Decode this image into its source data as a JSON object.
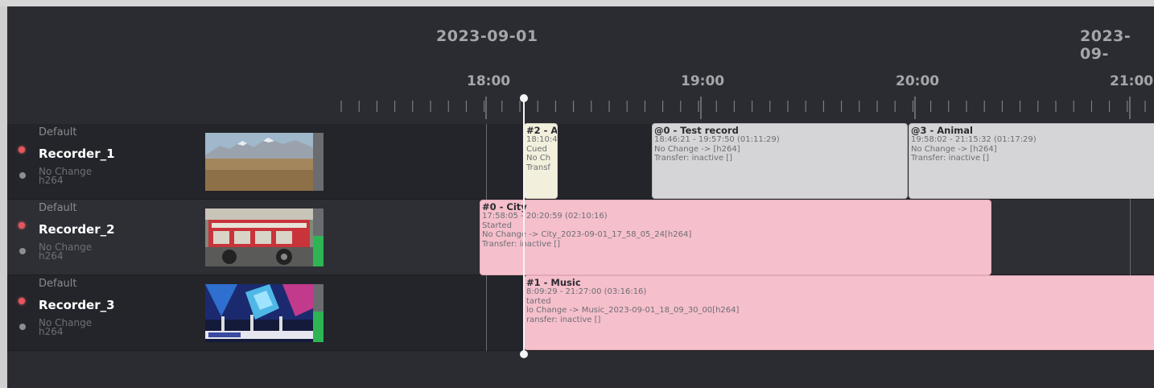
{
  "timeline": {
    "dates": [
      "2023-09-01",
      "2023-09-"
    ],
    "hours": [
      "18:00",
      "19:00",
      "20:00",
      "21:00"
    ]
  },
  "recorders": [
    {
      "profile": "Default",
      "name": "Recorder_1",
      "meta_line1": "No Change",
      "meta_line2": "h264",
      "status_color": "#e9545b",
      "thumbnail": "mountain landscape"
    },
    {
      "profile": "Default",
      "name": "Recorder_2",
      "meta_line1": "No Change",
      "meta_line2": "h264",
      "status_color": "#e9545b",
      "thumbnail": "fire truck"
    },
    {
      "profile": "Default",
      "name": "Recorder_3",
      "meta_line1": "No Change",
      "meta_line2": "h264",
      "status_color": "#e9545b",
      "thumbnail": "music stage"
    }
  ],
  "events": {
    "e_cued": {
      "title": "#2 - A",
      "time": "18:10:4",
      "status": "Cued",
      "transcode": "No Ch",
      "transfer": "Transf"
    },
    "e_test": {
      "title": "@0 - Test record",
      "time": "18:46:21 - 19:57:50 (01:11:29)",
      "transcode": "No Change -> [h264]",
      "transfer": "Transfer: inactive []"
    },
    "e_animal": {
      "title": "@3 - Animal",
      "time": "19:58:02 - 21:15:32 (01:17:29)",
      "transcode": "No Change -> [h264]",
      "transfer": "Transfer: inactive []"
    },
    "e_city": {
      "title": "#0 - City",
      "time": "17:58:05 - 20:20:59 (02:10:16)",
      "status": "Started",
      "transcode": "No Change -> City_2023-09-01_17_58_05_24[h264]",
      "transfer": "Transfer: inactive []"
    },
    "e_music": {
      "title": "#1 - Music",
      "time": "8:09:29 - 21:27:00 (03:16:16)",
      "status": "tarted",
      "transcode": "lo Change -> Music_2023-09-01_18_09_30_00[h264]",
      "transfer": "ransfer: inactive []"
    }
  },
  "colors": {
    "background": "#2b2c32",
    "event_scheduled": "#d5d5d7",
    "event_cued": "#f2f0dc",
    "event_recording": "#f5bfcc",
    "status_live": "#e9545b",
    "signal_ok": "#2fb453"
  }
}
